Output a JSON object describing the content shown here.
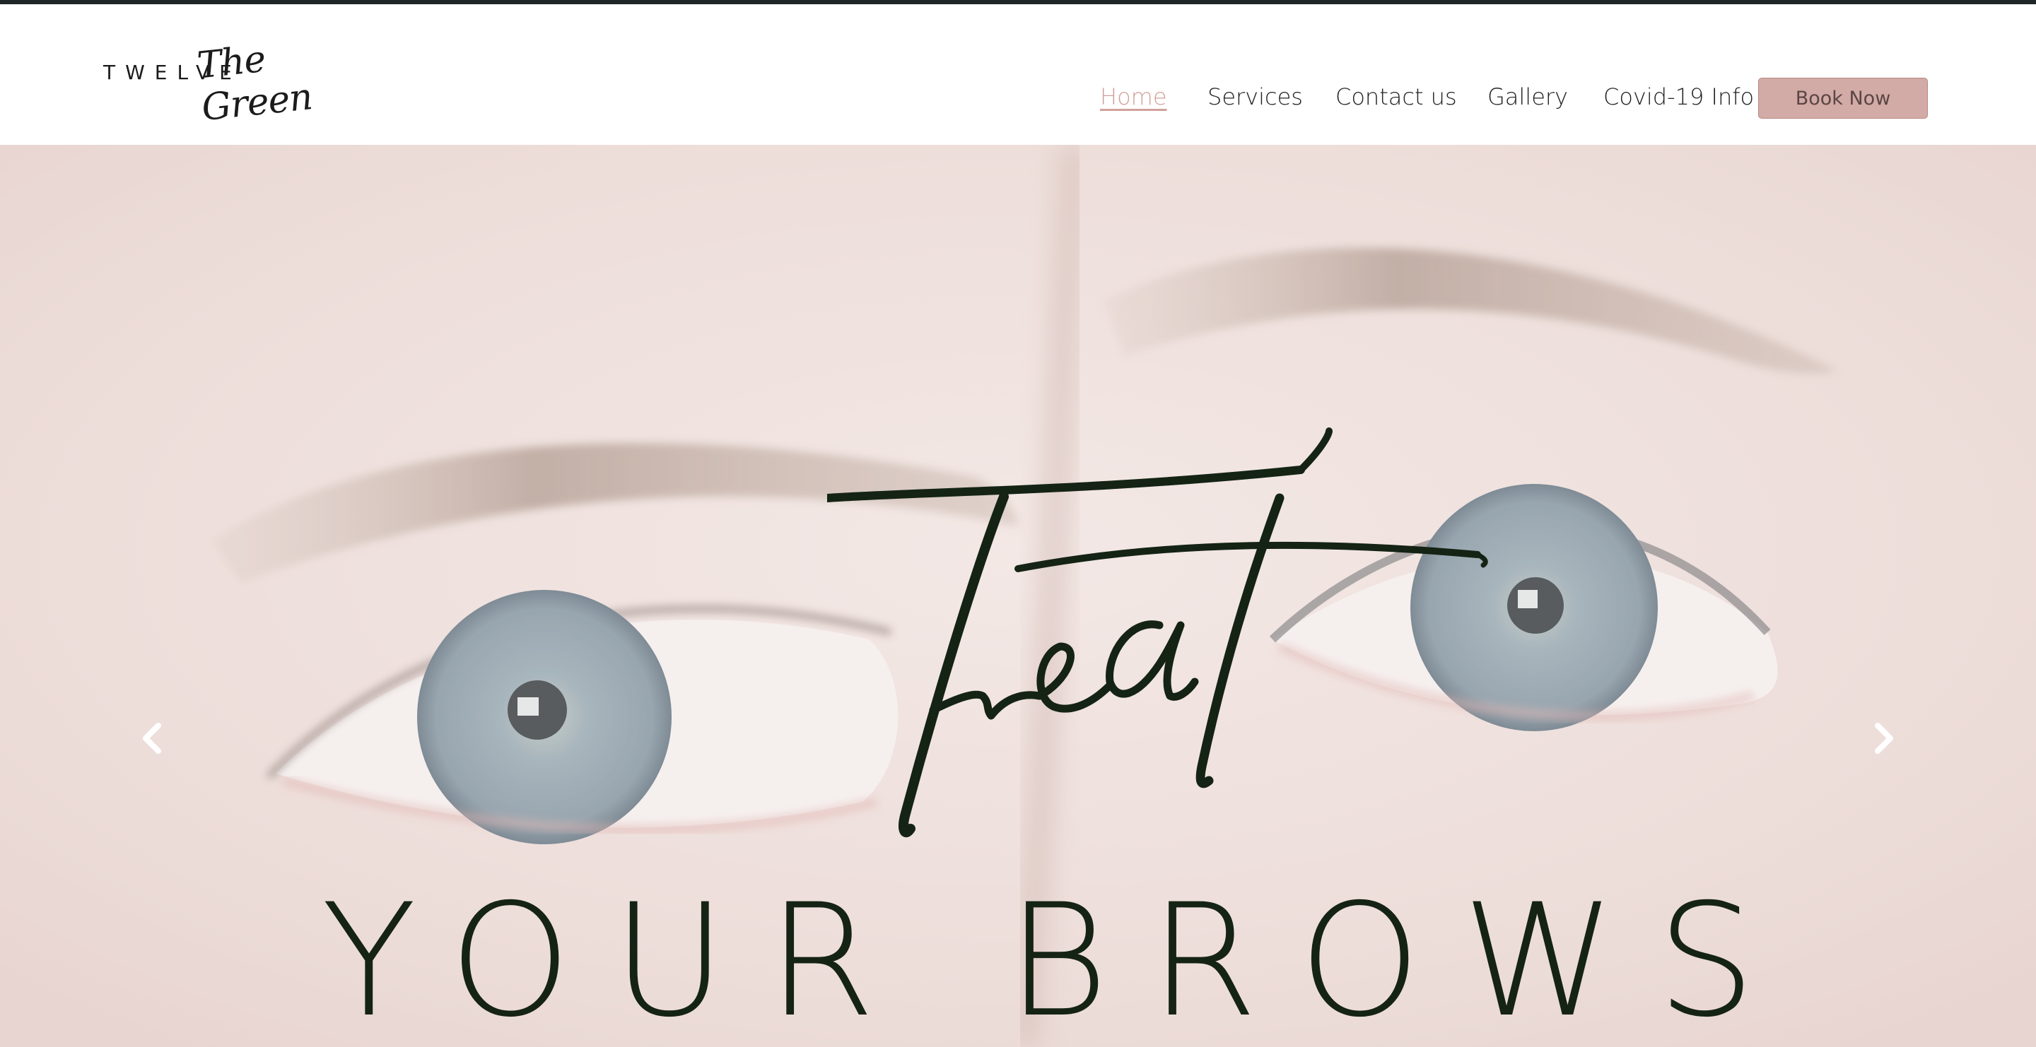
{
  "logo": {
    "wordmark": "TWELVE",
    "script": "The Green"
  },
  "nav": {
    "items": [
      {
        "label": "Home",
        "active": true
      },
      {
        "label": "Services",
        "active": false
      },
      {
        "label": "Contact us",
        "active": false
      },
      {
        "label": "Gallery",
        "active": false
      },
      {
        "label": "Covid-19 Info",
        "active": false
      }
    ],
    "book_button": "Book Now"
  },
  "hero": {
    "script_title": "Treat",
    "title": "YOUR BROWS",
    "prev_icon": "chevron-left-icon",
    "next_icon": "chevron-right-icon"
  },
  "colors": {
    "accent": "#d1a19b",
    "button_bg": "#d2aaa6",
    "hero_text": "#142314",
    "topline": "#1f2726"
  }
}
